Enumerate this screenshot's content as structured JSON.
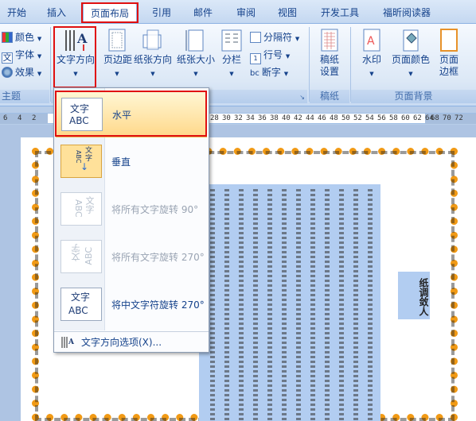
{
  "tabs": [
    "开始",
    "插入",
    "页面布局",
    "引用",
    "邮件",
    "审阅",
    "视图",
    "开发工具",
    "福昕阅读器"
  ],
  "theme_group": {
    "colors": "颜色",
    "fonts": "字体",
    "effects": "效果",
    "label": "主题"
  },
  "page_setup": {
    "text_direction": "文字方向",
    "margins": "页边距",
    "orientation": "纸张方向",
    "size": "纸张大小",
    "columns": "分栏",
    "breaks": "分隔符",
    "line_numbers": "行号",
    "hyphenation": "断字"
  },
  "manuscript": {
    "button": "稿纸设置",
    "label": "稿纸"
  },
  "page_background": {
    "watermark": "水印",
    "page_color": "页面颜色",
    "page_borders": "页面边框",
    "label": "页面背景"
  },
  "ruler": [
    "6",
    "4",
    "2",
    "28",
    "30",
    "32",
    "34",
    "36",
    "38",
    "40",
    "42",
    "44",
    "46",
    "48",
    "50",
    "52",
    "54",
    "56",
    "58",
    "60",
    "62",
    "64",
    "68",
    "70",
    "72"
  ],
  "menu": {
    "items": [
      {
        "label": "水平",
        "icon_text": "文字",
        "icon_sub": "ABC"
      },
      {
        "label": "垂直",
        "icon_text": "文字",
        "icon_sub": "ABC"
      },
      {
        "label": "将所有文字旋转 90°",
        "icon_text": "文字",
        "icon_sub": "ABC"
      },
      {
        "label": "将所有文字旋转 270°",
        "icon_text": "文字",
        "icon_sub": "ABC"
      },
      {
        "label": "将中文字符旋转 270°",
        "icon_text": "文字",
        "icon_sub": "ABC"
      }
    ],
    "options": "文字方向选项(X)..."
  },
  "doc": {
    "vertical_box": "纸调敛人"
  }
}
